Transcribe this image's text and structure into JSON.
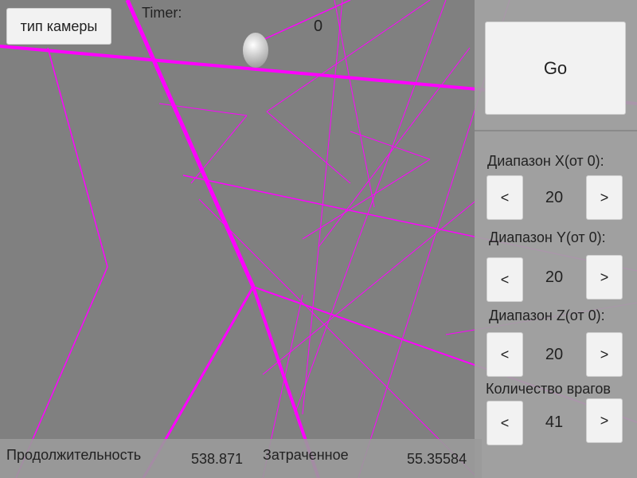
{
  "toolbar": {
    "camera_button": "тип камеры",
    "timer_label": "Timer:",
    "timer_value": "0"
  },
  "panel": {
    "go_button": "Go",
    "range_x": {
      "label": "Диапазон X(от 0):",
      "dec": "<",
      "value": "20",
      "inc": ">"
    },
    "range_y": {
      "label": "Диапазон Y(от 0):",
      "dec": "<",
      "value": "20",
      "inc": ">"
    },
    "range_z": {
      "label": "Диапазон Z(от 0):",
      "dec": "<",
      "value": "20",
      "inc": ">"
    },
    "enemies": {
      "label": "Количество врагов",
      "dec": "<",
      "value": "41",
      "inc": ">"
    }
  },
  "stats": {
    "duration_label": "Продолжительность",
    "duration_value": "538.871",
    "spent_label": "Затраченное",
    "spent_value": "55.35584"
  },
  "colors": {
    "background": "#808080",
    "trajectory": "#ff00ff",
    "panel": "#a3a3a3",
    "button": "#f2f2f2"
  },
  "icons": {
    "sphere": "player-sphere"
  }
}
